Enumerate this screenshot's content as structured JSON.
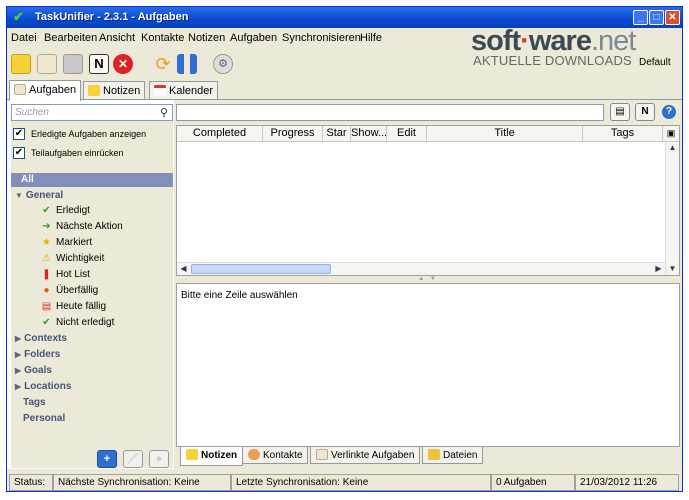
{
  "window": {
    "title": "TaskUnifier - 2.3.1 - Aufgaben"
  },
  "menu": [
    "Datei",
    "Bearbeiten",
    "Ansicht",
    "Kontakte",
    "Notizen",
    "Aufgaben",
    "Synchronisieren",
    "Hilfe"
  ],
  "watermark": {
    "brand": "soft",
    "brand_b": "ware",
    "brand_tld": ".net",
    "tagline": "AKTUELLE DOWNLOADS"
  },
  "profile": "Default",
  "tabs": [
    "Aufgaben",
    "Notizen",
    "Kalender"
  ],
  "left": {
    "search_placeholder": "Suchen",
    "show_completed": "Erledigte Aufgaben anzeigen",
    "indent_subtasks": "Teilaufgaben einrücken",
    "all": "All",
    "general": "General",
    "general_items": [
      "Erledigt",
      "Nächste Aktion",
      "Markiert",
      "Wichtigkeit",
      "Hot List",
      "Überfällig",
      "Heute fällig",
      "Nicht erledigt"
    ],
    "contexts": "Contexts",
    "folders": "Folders",
    "goals": "Goals",
    "locations": "Locations",
    "tags": "Tags",
    "personal": "Personal"
  },
  "grid": {
    "columns": [
      "Completed",
      "Progress",
      "Star",
      "Show...",
      "Edit",
      "Title",
      "Tags"
    ]
  },
  "detail": {
    "message": "Bitte eine Zeile auswählen"
  },
  "bottom_tabs": [
    "Notizen",
    "Kontakte",
    "Verlinkte Aufgaben",
    "Dateien"
  ],
  "status": {
    "label": "Status:",
    "next_sync": "Nächste Synchronisation: Keine",
    "last_sync": "Letzte Synchronisation: Keine",
    "tasks": "0 Aufgaben",
    "datetime": "21/03/2012 11:26"
  },
  "colors": {
    "titlebar": "#0a4ad0",
    "selection": "#8090b8",
    "accent": "#2e6fcf"
  },
  "icons": {
    "general_items": [
      "check-icon",
      "next-action-icon",
      "star-icon",
      "warning-icon",
      "hotlist-icon",
      "overdue-icon",
      "calendar-icon",
      "check-icon"
    ]
  }
}
